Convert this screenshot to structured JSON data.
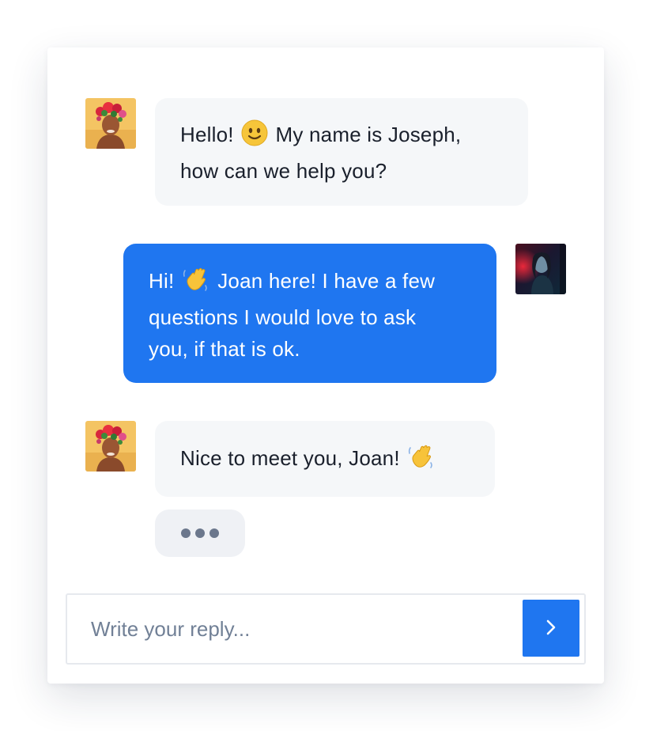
{
  "chat": {
    "messages": [
      {
        "sender": "Joseph",
        "direction": "incoming",
        "line1_before_emoji": "Hello! ",
        "emoji1": "slightly-smiling-face",
        "line1_after_emoji": " My name is Joseph,",
        "line2": "how can we help you?"
      },
      {
        "sender": "Joan",
        "direction": "outgoing",
        "line1_before_emoji": "Hi! ",
        "emoji1": "waving-hand",
        "line1_after_emoji": " Joan here! I have a few",
        "line2": "questions I would love to ask",
        "line3": "you, if that is ok."
      },
      {
        "sender": "Joseph",
        "direction": "incoming",
        "line1_before_emoji": "Nice to meet you, Joan! ",
        "emoji1": "waving-hand"
      }
    ],
    "typing_indicator": "typing"
  },
  "composer": {
    "placeholder": "Write your reply...",
    "value": "",
    "send_icon": "chevron-right-icon"
  },
  "colors": {
    "outgoing_bubble": "#1f76f0",
    "incoming_bubble": "#f5f7f9",
    "send_button": "#1f76f0",
    "typing_dots": "#6b778c",
    "placeholder_text": "#718096"
  }
}
